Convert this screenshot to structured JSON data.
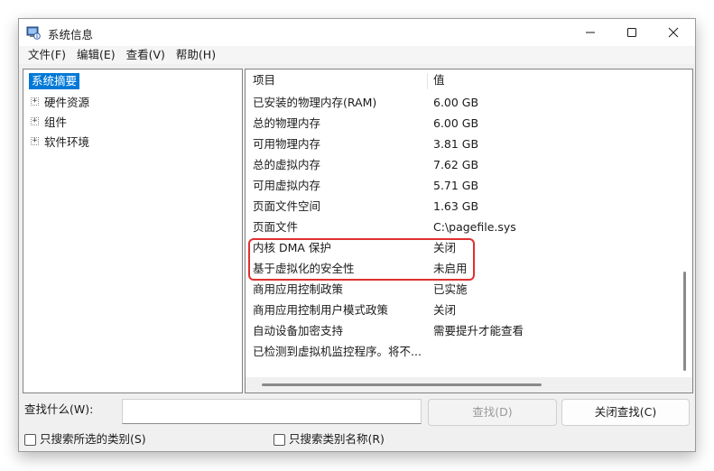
{
  "window": {
    "title": "系统信息"
  },
  "menu": [
    "文件(F)",
    "编辑(E)",
    "查看(V)",
    "帮助(H)"
  ],
  "tree": {
    "root": "系统摘要",
    "children": [
      {
        "expander": "+",
        "label": "硬件资源"
      },
      {
        "expander": "+",
        "label": "组件"
      },
      {
        "expander": "+",
        "label": "软件环境"
      }
    ]
  },
  "table": {
    "headers": {
      "item": "项目",
      "value": "值"
    },
    "rows": [
      {
        "item": "已安装的物理内存(RAM)",
        "value": "6.00 GB"
      },
      {
        "item": "总的物理内存",
        "value": "6.00 GB"
      },
      {
        "item": "可用物理内存",
        "value": "3.81 GB"
      },
      {
        "item": "总的虚拟内存",
        "value": "7.62 GB"
      },
      {
        "item": "可用虚拟内存",
        "value": "5.71 GB"
      },
      {
        "item": "页面文件空间",
        "value": "1.63 GB"
      },
      {
        "item": "页面文件",
        "value": "C:\\pagefile.sys"
      },
      {
        "item": "内核 DMA 保护",
        "value": "关闭"
      },
      {
        "item": "基于虚拟化的安全性",
        "value": "未启用"
      },
      {
        "item": "商用应用控制政策",
        "value": "已实施"
      },
      {
        "item": "商用应用控制用户模式政策",
        "value": "关闭"
      },
      {
        "item": "自动设备加密支持",
        "value": "需要提升才能查看"
      },
      {
        "item": "已检测到虚拟机监控程序。将不...",
        "value": ""
      }
    ]
  },
  "find": {
    "label": "查找什么(W):",
    "input_value": "",
    "find_button": "查找(D)",
    "close_find_button": "关闭查找(C)",
    "check_selected_category": "只搜索所选的类别(S)",
    "check_category_names": "只搜索类别名称(R)"
  },
  "colors": {
    "highlight_border": "#e03030",
    "selection": "#0078d7"
  },
  "icons": {
    "app": "system-info-icon",
    "minimize": "minimize-icon",
    "maximize": "maximize-icon",
    "close": "close-icon"
  }
}
